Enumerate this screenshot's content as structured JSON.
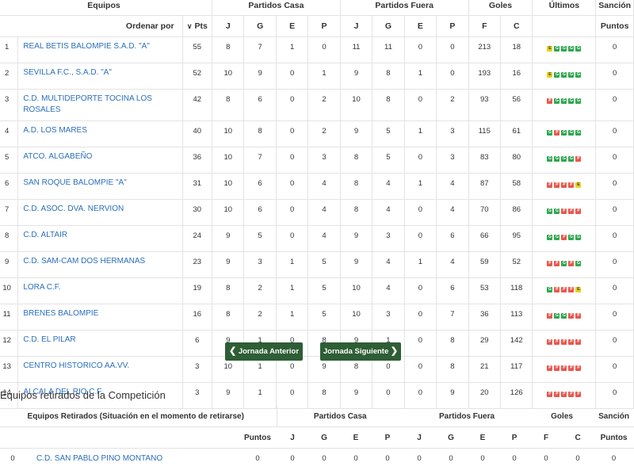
{
  "standings": {
    "headers": {
      "teams": "Equipos",
      "home": "Partidos Casa",
      "away": "Partidos Fuera",
      "goals": "Goles",
      "last": "Últimos",
      "sanction": "Sanción",
      "order_by": "Ordenar por",
      "pts": "Pts",
      "j": "J",
      "g": "G",
      "e": "E",
      "p": "P",
      "f": "F",
      "c": "C",
      "points": "Puntos"
    },
    "rows": [
      {
        "pos": "1",
        "name": "REAL BETIS BALOMPIE S.A.D. \"A\"",
        "pts": "55",
        "hj": "8",
        "hg": "7",
        "he": "1",
        "hp": "0",
        "aj": "11",
        "ag": "11",
        "ae": "0",
        "ap": "0",
        "f": "213",
        "c": "18",
        "form": [
          "E",
          "G",
          "G",
          "G",
          "G"
        ],
        "sancion": "0"
      },
      {
        "pos": "2",
        "name": "SEVILLA F.C., S.A.D. \"A\"",
        "pts": "52",
        "hj": "10",
        "hg": "9",
        "he": "0",
        "hp": "1",
        "aj": "9",
        "ag": "8",
        "ae": "1",
        "ap": "0",
        "f": "193",
        "c": "16",
        "form": [
          "E",
          "G",
          "G",
          "G",
          "G"
        ],
        "sancion": "0"
      },
      {
        "pos": "3",
        "name": "C.D. MULTIDEPORTE TOCINA LOS ROSALES",
        "pts": "42",
        "hj": "8",
        "hg": "6",
        "he": "0",
        "hp": "2",
        "aj": "10",
        "ag": "8",
        "ae": "0",
        "ap": "2",
        "f": "93",
        "c": "56",
        "form": [
          "P",
          "G",
          "G",
          "G",
          "G"
        ],
        "sancion": "0"
      },
      {
        "pos": "4",
        "name": "A.D. LOS MARES",
        "pts": "40",
        "hj": "10",
        "hg": "8",
        "he": "0",
        "hp": "2",
        "aj": "9",
        "ag": "5",
        "ae": "1",
        "ap": "3",
        "f": "115",
        "c": "61",
        "form": [
          "G",
          "P",
          "G",
          "G",
          "G"
        ],
        "sancion": "0"
      },
      {
        "pos": "5",
        "name": "ATCO. ALGABEÑO",
        "pts": "36",
        "hj": "10",
        "hg": "7",
        "he": "0",
        "hp": "3",
        "aj": "8",
        "ag": "5",
        "ae": "0",
        "ap": "3",
        "f": "83",
        "c": "80",
        "form": [
          "G",
          "G",
          "G",
          "G",
          "P"
        ],
        "sancion": "0"
      },
      {
        "pos": "6",
        "name": "SAN ROQUE BALOMPIE \"A\"",
        "pts": "31",
        "hj": "10",
        "hg": "6",
        "he": "0",
        "hp": "4",
        "aj": "8",
        "ag": "4",
        "ae": "1",
        "ap": "4",
        "f": "87",
        "c": "58",
        "form": [
          "P",
          "P",
          "P",
          "P",
          "E"
        ],
        "sancion": "0"
      },
      {
        "pos": "7",
        "name": "C.D. ASOC. DVA. NERVION",
        "pts": "30",
        "hj": "10",
        "hg": "6",
        "he": "0",
        "hp": "4",
        "aj": "8",
        "ag": "4",
        "ae": "0",
        "ap": "4",
        "f": "70",
        "c": "86",
        "form": [
          "G",
          "G",
          "P",
          "P",
          "P"
        ],
        "sancion": "0"
      },
      {
        "pos": "8",
        "name": "C.D. ALTAIR",
        "pts": "24",
        "hj": "9",
        "hg": "5",
        "he": "0",
        "hp": "4",
        "aj": "9",
        "ag": "3",
        "ae": "0",
        "ap": "6",
        "f": "66",
        "c": "95",
        "form": [
          "G",
          "G",
          "P",
          "G",
          "G"
        ],
        "sancion": "0"
      },
      {
        "pos": "9",
        "name": "C.D. SAM-CAM DOS HERMANAS",
        "pts": "23",
        "hj": "9",
        "hg": "3",
        "he": "1",
        "hp": "5",
        "aj": "9",
        "ag": "4",
        "ae": "1",
        "ap": "4",
        "f": "59",
        "c": "52",
        "form": [
          "P",
          "P",
          "G",
          "P",
          "G"
        ],
        "sancion": "0"
      },
      {
        "pos": "10",
        "name": "LORA C.F.",
        "pts": "19",
        "hj": "8",
        "hg": "2",
        "he": "1",
        "hp": "5",
        "aj": "10",
        "ag": "4",
        "ae": "0",
        "ap": "6",
        "f": "53",
        "c": "118",
        "form": [
          "G",
          "P",
          "P",
          "P",
          "E"
        ],
        "sancion": "0"
      },
      {
        "pos": "11",
        "name": "BRENES BALOMPIE",
        "pts": "16",
        "hj": "8",
        "hg": "2",
        "he": "1",
        "hp": "5",
        "aj": "10",
        "ag": "3",
        "ae": "0",
        "ap": "7",
        "f": "36",
        "c": "113",
        "form": [
          "P",
          "G",
          "G",
          "P",
          "P"
        ],
        "sancion": "0"
      },
      {
        "pos": "12",
        "name": "C.D. EL PILAR",
        "pts": "6",
        "hj": "9",
        "hg": "1",
        "he": "0",
        "hp": "8",
        "aj": "9",
        "ag": "1",
        "ae": "0",
        "ap": "8",
        "f": "29",
        "c": "142",
        "form": [
          "P",
          "P",
          "P",
          "P",
          "P"
        ],
        "sancion": "0"
      },
      {
        "pos": "13",
        "name": "CENTRO HISTORICO AA.VV.",
        "pts": "3",
        "hj": "10",
        "hg": "1",
        "he": "0",
        "hp": "9",
        "aj": "8",
        "ag": "0",
        "ae": "0",
        "ap": "8",
        "f": "21",
        "c": "117",
        "form": [
          "P",
          "P",
          "P",
          "P",
          "P"
        ],
        "sancion": "0"
      },
      {
        "pos": "14",
        "name": "ALCALA DEL RIO C.F.",
        "pts": "3",
        "hj": "9",
        "hg": "1",
        "he": "0",
        "hp": "8",
        "aj": "9",
        "ag": "0",
        "ae": "0",
        "ap": "9",
        "f": "20",
        "c": "126",
        "form": [
          "P",
          "P",
          "P",
          "P",
          "P"
        ],
        "sancion": "0"
      }
    ]
  },
  "nav": {
    "prev_label": "Jornada Anterior",
    "next_label": "Jornada Siguiente"
  },
  "retired": {
    "title": "Equipos retirados de la Competición",
    "headers": {
      "teams": "Equipos Retirados (Situación en el momento de retirarse)",
      "home": "Partidos Casa",
      "away": "Partidos Fuera",
      "goals": "Goles",
      "sanction": "Sanción",
      "points": "Puntos",
      "j": "J",
      "g": "G",
      "e": "E",
      "p": "P",
      "f": "F",
      "c": "C",
      "sanction_points": "Puntos"
    },
    "rows": [
      {
        "pos": "0",
        "name": "C.D. SAN PABLO PINO MONTANO",
        "pts": "0",
        "hj": "0",
        "hg": "0",
        "he": "0",
        "hp": "0",
        "aj": "0",
        "ag": "0",
        "ae": "0",
        "ap": "0",
        "f": "0",
        "c": "0",
        "sancion": "0"
      }
    ]
  },
  "colors": {
    "link": "#2a6ebb",
    "button": "#2e5e35",
    "win": "#2fa84f",
    "loss": "#e9574d",
    "draw": "#e8d21a"
  }
}
